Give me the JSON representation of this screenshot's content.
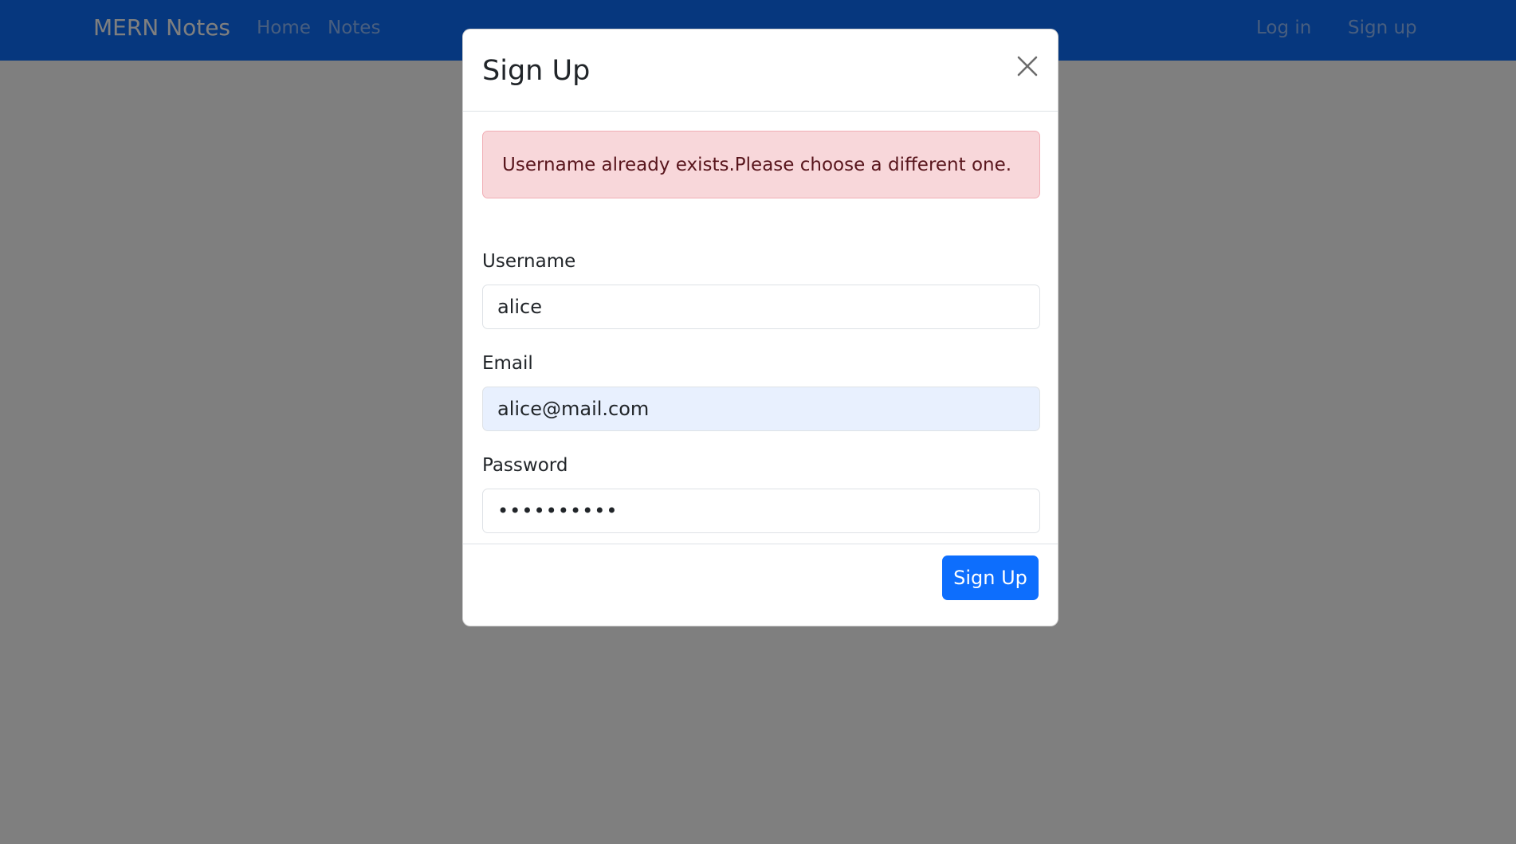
{
  "navbar": {
    "brand": "MERN Notes",
    "links": [
      "Home",
      "Notes"
    ],
    "auth": {
      "login": "Log in",
      "signup": "Sign up"
    },
    "bg_color": "#0d6efd"
  },
  "modal": {
    "title": "Sign Up",
    "close_icon": "close-icon",
    "alert": "Username already exists.Please choose a different one.",
    "fields": {
      "username": {
        "label": "Username",
        "value": "alice"
      },
      "email": {
        "label": "Email",
        "value": "alice@mail.com"
      },
      "password": {
        "label": "Password",
        "value": "••••••••••"
      }
    },
    "submit_label": "Sign Up"
  },
  "colors": {
    "primary": "#0d6efd",
    "alert_bg": "#f8d7da",
    "alert_text": "#58151c",
    "autofill_bg": "#e8f0fe"
  }
}
